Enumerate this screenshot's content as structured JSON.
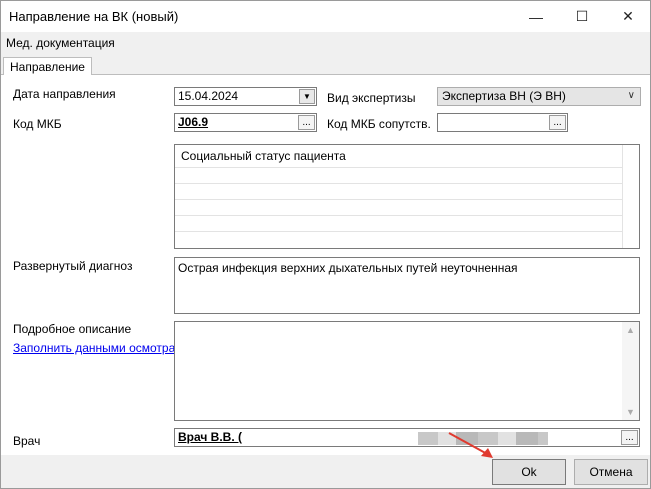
{
  "window": {
    "title": "Направление на ВК (новый)"
  },
  "menu": {
    "item": "Мед. документация"
  },
  "tabs": {
    "active": "Направление"
  },
  "form": {
    "date_label": "Дата направления",
    "date_value": "15.04.2024",
    "exam_type_label": "Вид экспертизы",
    "exam_type_value": "Экспертиза ВН (Э ВН)",
    "icd_label": "Код МКБ",
    "icd_value": "J06.9",
    "icd_related_label": "Код МКБ сопутств.",
    "icd_related_value": "",
    "ellipsis": "...",
    "social_status_header": "Социальный статус пациента",
    "diagnosis_label": "Развернутый диагноз",
    "diagnosis_value": "Острая инфекция верхних дыхательных путей неуточненная",
    "description_label": "Подробное описание",
    "fill_link": "Заполнить данными осмотра",
    "doctor_label": "Врач",
    "doctor_value": "Врач В.В. ("
  },
  "buttons": {
    "ok": "Ok",
    "cancel": "Отмена"
  },
  "colors": {
    "link": "#0000ee",
    "arrow": "#e03a2f"
  }
}
